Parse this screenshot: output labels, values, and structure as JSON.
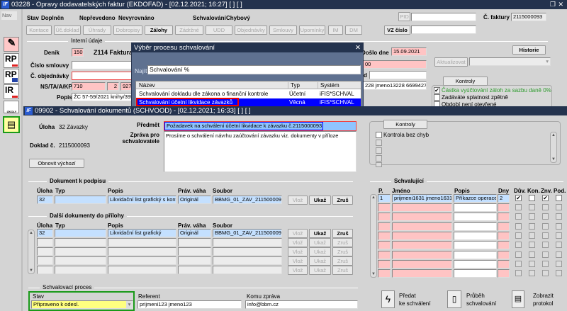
{
  "bg_window": {
    "title": "03228 - Opravy dodavatelských faktur (EKDOFAD) - [02.12.2021; 16:27] [ ] [ ]",
    "nav": "Nav",
    "stav_label": "Stav",
    "stav_value": "Doplněn",
    "stav2": "Nepřevedeno",
    "stav3": "Nevyrovnáno",
    "schvalovani_label": "Schvalování",
    "schvalovani_value": "Chybový",
    "tabs": [
      "Kontace",
      "Úč.doklad",
      "Úhrady",
      "Dobropisy",
      "Zálohy",
      "Zádržné",
      "UDD",
      "Objednávky",
      "Smlouvy",
      "Upomínky",
      "IM",
      "DM"
    ],
    "active_tab": "Zálohy",
    "pid_button": "PID",
    "pid_value": "",
    "faktura_label": "Č. faktury",
    "faktura_value": "2115000093",
    "vz_button": "VZ číslo",
    "vz_value": "",
    "interni_udaje": "Interní údaje",
    "denik_label": "Deník",
    "denik_value": "150",
    "denik_name": "Z114 Faktura",
    "smlouva_label": "Číslo smlouvy",
    "smlouva_value": "",
    "objednavka_label": "Č. objednávky",
    "objednavka_value": "",
    "ns_label": "NS/TA/A/KP",
    "ns_values": [
      "710",
      "2",
      "9275"
    ],
    "popis_label": "Popis",
    "popis_value": "ŽC 57-59/2021 knihy/395",
    "doslo_label": "Došlo dne",
    "doslo_value": "15.09.2021",
    "row2_value": "00",
    "row3_label": "d",
    "row3_value": "",
    "row4_value": "228 jmeno13228 66994273",
    "historie": "Historie",
    "aktualizovat": "Aktualizovat",
    "kontroly": "Kontroly",
    "kontroly_items": [
      {
        "label": "Částka vyúčtování záloh za sazbu daně 0%",
        "checked": true,
        "color": "#2e9b2e"
      },
      {
        "label": "Zadáváte splatnost zpětně",
        "checked": false
      },
      {
        "label": "Období není otevřené",
        "checked": false
      }
    ]
  },
  "dialog": {
    "title": "Výběr procesu schvalování",
    "find_label": "Najít",
    "find_value": "Schvalování %",
    "columns": [
      "Název",
      "Typ",
      "Systém"
    ],
    "rows": [
      {
        "name": "Schvalování dokladu dle zákona o finanční kontrole",
        "type": "Účetní",
        "system": "iFIS*SCHVAL"
      },
      {
        "name": "Schvalování účetní likvidace závazků",
        "type": "Věcná",
        "system": "iFIS*SCHVAL",
        "selected": true
      }
    ]
  },
  "sidebar": {
    "icons": [
      "approve-pen-icon",
      "RP",
      "RP",
      "IR",
      "ÚKOLY",
      "task-list-icon"
    ]
  },
  "fg_window": {
    "title": "09902 - Schvalování dokumentů (SCHVOOD) - [02.12.2021; 16:33] [ ] [ ]",
    "uloha_label": "Úloha",
    "uloha_value": "32 Závazky",
    "doklad_label": "Doklad č.",
    "doklad_value": "2115000093",
    "obnovit": "Obnovit výchozí",
    "predmet_label": "Předmět",
    "predmet_value": "Požadavek na schválení účetní likvidace k závazku č.2115000093",
    "zprava_label1": "Zpráva pro",
    "zprava_label2": "schvalovatele",
    "zprava_value": "Prosíme o schválení návrhu zaúčtování závazku viz. dokumenty v příloze",
    "kontroly": "Kontroly",
    "kontroly_items": [
      "Kontrola bez chyb"
    ],
    "doc_header": "Dokument k podpisu",
    "doc_columns": [
      "Úloha",
      "Typ",
      "Popis",
      "Práv. váha",
      "Soubor"
    ],
    "doc_row": {
      "uloha": "32",
      "typ": "",
      "popis": "Likvidační list grafický s kont",
      "vaha": "Originál",
      "soubor": "BBMG_01_ZAV_2115000093"
    },
    "btn_vloz": "Vlož",
    "btn_ukaz": "Ukaž",
    "btn_zrus": "Zruš",
    "att_header": "Další dokumenty do přílohy",
    "att_rows": [
      {
        "uloha": "32",
        "typ": "",
        "popis": "Likvidační list grafický",
        "vaha": "Originál",
        "soubor": "BBMG_01_ZAV_2115000093"
      }
    ],
    "appr_header": "Schvalující",
    "appr_columns": [
      "P.",
      "Jméno",
      "Popis",
      "Dny",
      "Dův.",
      "Kon.",
      "Znv.",
      "Pod."
    ],
    "appr_rows": [
      {
        "p": "1",
        "jmeno": "prijmeni1631 jmeno1631",
        "popis": "Příkazce operace",
        "dny": "2",
        "duv": true,
        "kon": false,
        "znv": true,
        "pod": false
      }
    ],
    "proc_header": "Schvalovací proces",
    "stav_label": "Stav",
    "stav_value": "Připraveno k odesl.",
    "referent_label": "Referent",
    "referent_value": "prijmeni123 jmeno123",
    "komu_label": "Komu zpráva",
    "komu_value": "info@bbm.cz",
    "predat1": "Předat",
    "predat2": "ke schválení",
    "prubeh1": "Průběh",
    "prubeh2": "schvalování",
    "zobrazit1": "Zobrazit",
    "zobrazit2": "protokol"
  }
}
